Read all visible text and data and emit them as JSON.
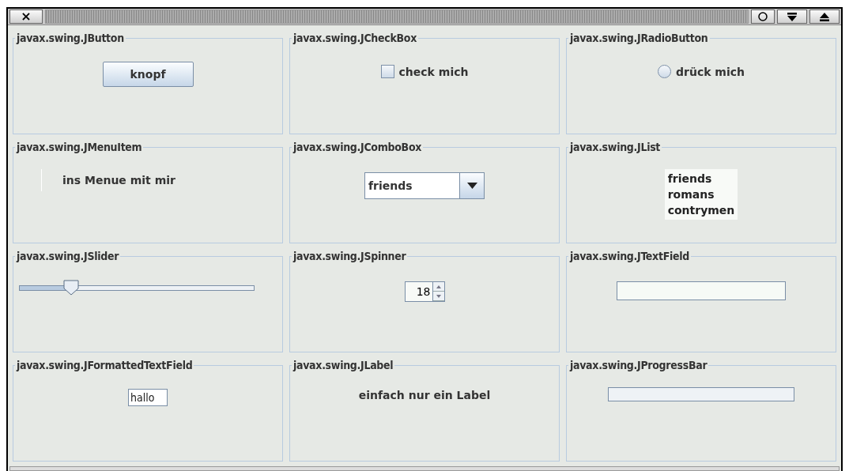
{
  "window": {
    "close_button": "×"
  },
  "panels": [
    {
      "kind": "button",
      "title": "javax.swing.JButton",
      "label": "knopf"
    },
    {
      "kind": "checkbox",
      "title": "javax.swing.JCheckBox",
      "label": "check mich",
      "checked": false
    },
    {
      "kind": "radio",
      "title": "javax.swing.JRadioButton",
      "label": "drück mich",
      "selected": false
    },
    {
      "kind": "menuitem",
      "title": "javax.swing.JMenuItem",
      "label": "ins Menue mit mir"
    },
    {
      "kind": "combo",
      "title": "javax.swing.JComboBox",
      "value": "friends"
    },
    {
      "kind": "list",
      "title": "javax.swing.JList",
      "items": [
        {
          "label": "friends",
          "selected": false
        },
        {
          "label": "romans",
          "selected": false
        },
        {
          "label": "contrymen",
          "selected": false
        }
      ]
    },
    {
      "kind": "slider",
      "title": "javax.swing.JSlider",
      "level": 0.22
    },
    {
      "kind": "spinner",
      "title": "javax.swing.JSpinner",
      "value": "18"
    },
    {
      "kind": "textfield",
      "title": "javax.swing.JTextField"
    },
    {
      "kind": "formatted",
      "title": "javax.swing.JFormattedTextField",
      "value": "hallo"
    },
    {
      "kind": "label",
      "title": "javax.swing.JLabel",
      "label": "einfach nur ein Label"
    },
    {
      "kind": "progress",
      "title": "javax.swing.JProgressBar",
      "level": 0
    }
  ]
}
